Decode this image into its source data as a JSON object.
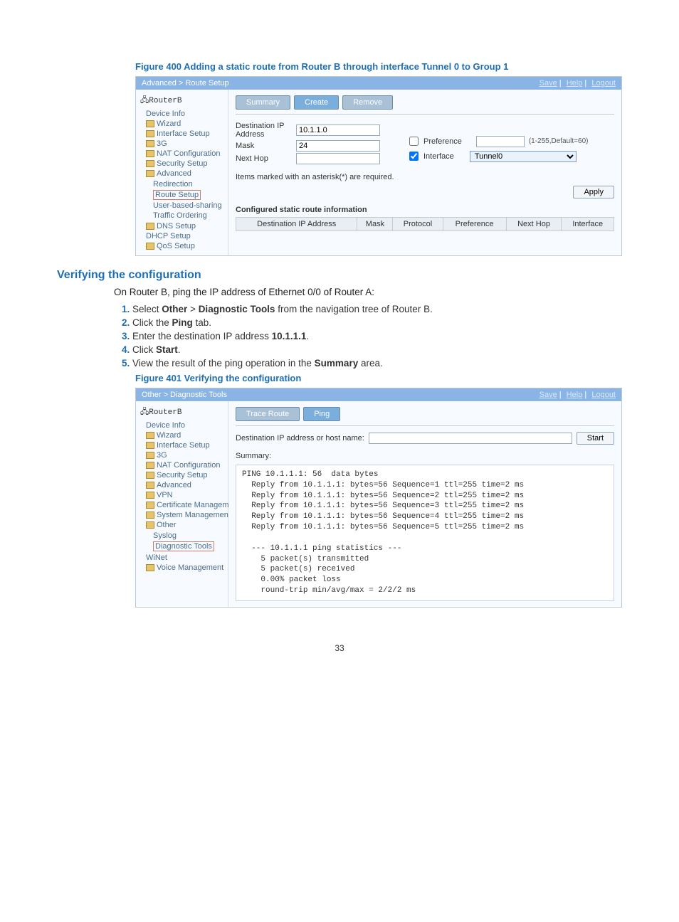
{
  "fig400": {
    "caption": "Figure 400 Adding a static route from Router B through interface Tunnel 0 to Group 1",
    "breadcrumb": "Advanced > Route Setup",
    "toplinks": {
      "save": "Save",
      "help": "Help",
      "logout": "Logout"
    },
    "device": "RouterB",
    "nav": {
      "deviceinfo": "Device Info",
      "wizard": "Wizard",
      "ifsetup": "Interface Setup",
      "g3": "3G",
      "nat": "NAT Configuration",
      "sec": "Security Setup",
      "adv": "Advanced",
      "redir": "Redirection",
      "route": "Route Setup",
      "ubs": "User-based-sharing",
      "traf": "Traffic Ordering",
      "dns": "DNS Setup",
      "dhcp": "DHCP Setup",
      "qos": "QoS Setup"
    },
    "tabs": {
      "summary": "Summary",
      "create": "Create",
      "remove": "Remove"
    },
    "labels": {
      "destip": "Destination IP Address",
      "mask": "Mask",
      "nexthop": "Next Hop",
      "pref": "Preference",
      "iface": "Interface"
    },
    "values": {
      "destip": "10.1.1.0",
      "mask": "24",
      "nexthop": "",
      "pref": "",
      "iface": "Tunnel0"
    },
    "hint_pref": "(1-255,Default=60)",
    "note": "Items marked with an asterisk(*) are required.",
    "apply": "Apply",
    "sectitle": "Configured static route information",
    "th": {
      "dest": "Destination IP Address",
      "mask": "Mask",
      "proto": "Protocol",
      "pref": "Preference",
      "nexthop": "Next Hop",
      "iface": "Interface"
    }
  },
  "verify": {
    "heading": "Verifying the configuration",
    "para": "On Router B, ping the IP address of Ethernet 0/0 of Router A:",
    "step1_a": "Select ",
    "step1_b": "Other",
    "step1_c": " > ",
    "step1_d": "Diagnostic Tools",
    "step1_e": " from the navigation tree of Router B.",
    "step2_a": "Click the ",
    "step2_b": "Ping",
    "step2_c": " tab.",
    "step3_a": "Enter the destination IP address ",
    "step3_b": "10.1.1.1",
    "step3_c": ".",
    "step4_a": "Click ",
    "step4_b": "Start",
    "step4_c": ".",
    "step5_a": "View the result of the ping operation in the ",
    "step5_b": "Summary",
    "step5_c": " area."
  },
  "fig401": {
    "caption": "Figure 401 Verifying the configuration",
    "breadcrumb": "Other > Diagnostic Tools",
    "toplinks": {
      "save": "Save",
      "help": "Help",
      "logout": "Logout"
    },
    "device": "RouterB",
    "nav": {
      "deviceinfo": "Device Info",
      "wizard": "Wizard",
      "ifsetup": "Interface Setup",
      "g3": "3G",
      "nat": "NAT Configuration",
      "sec": "Security Setup",
      "adv": "Advanced",
      "vpn": "VPN",
      "cert": "Certificate Managem",
      "sys": "System Managemen",
      "other": "Other",
      "syslog": "Syslog",
      "diag": "Diagnostic Tools",
      "winet": "WiNet",
      "voice": "Voice Management"
    },
    "tabs": {
      "trace": "Trace Route",
      "ping": "Ping"
    },
    "destlabel": "Destination IP address or host name:",
    "destval": "",
    "start": "Start",
    "summarylabel": "Summary:",
    "output": "PING 10.1.1.1: 56  data bytes\n  Reply from 10.1.1.1: bytes=56 Sequence=1 ttl=255 time=2 ms\n  Reply from 10.1.1.1: bytes=56 Sequence=2 ttl=255 time=2 ms\n  Reply from 10.1.1.1: bytes=56 Sequence=3 ttl=255 time=2 ms\n  Reply from 10.1.1.1: bytes=56 Sequence=4 ttl=255 time=2 ms\n  Reply from 10.1.1.1: bytes=56 Sequence=5 ttl=255 time=2 ms\n\n  --- 10.1.1.1 ping statistics ---\n    5 packet(s) transmitted\n    5 packet(s) received\n    0.00% packet loss\n    round-trip min/avg/max = 2/2/2 ms"
  },
  "pagenum": "33"
}
